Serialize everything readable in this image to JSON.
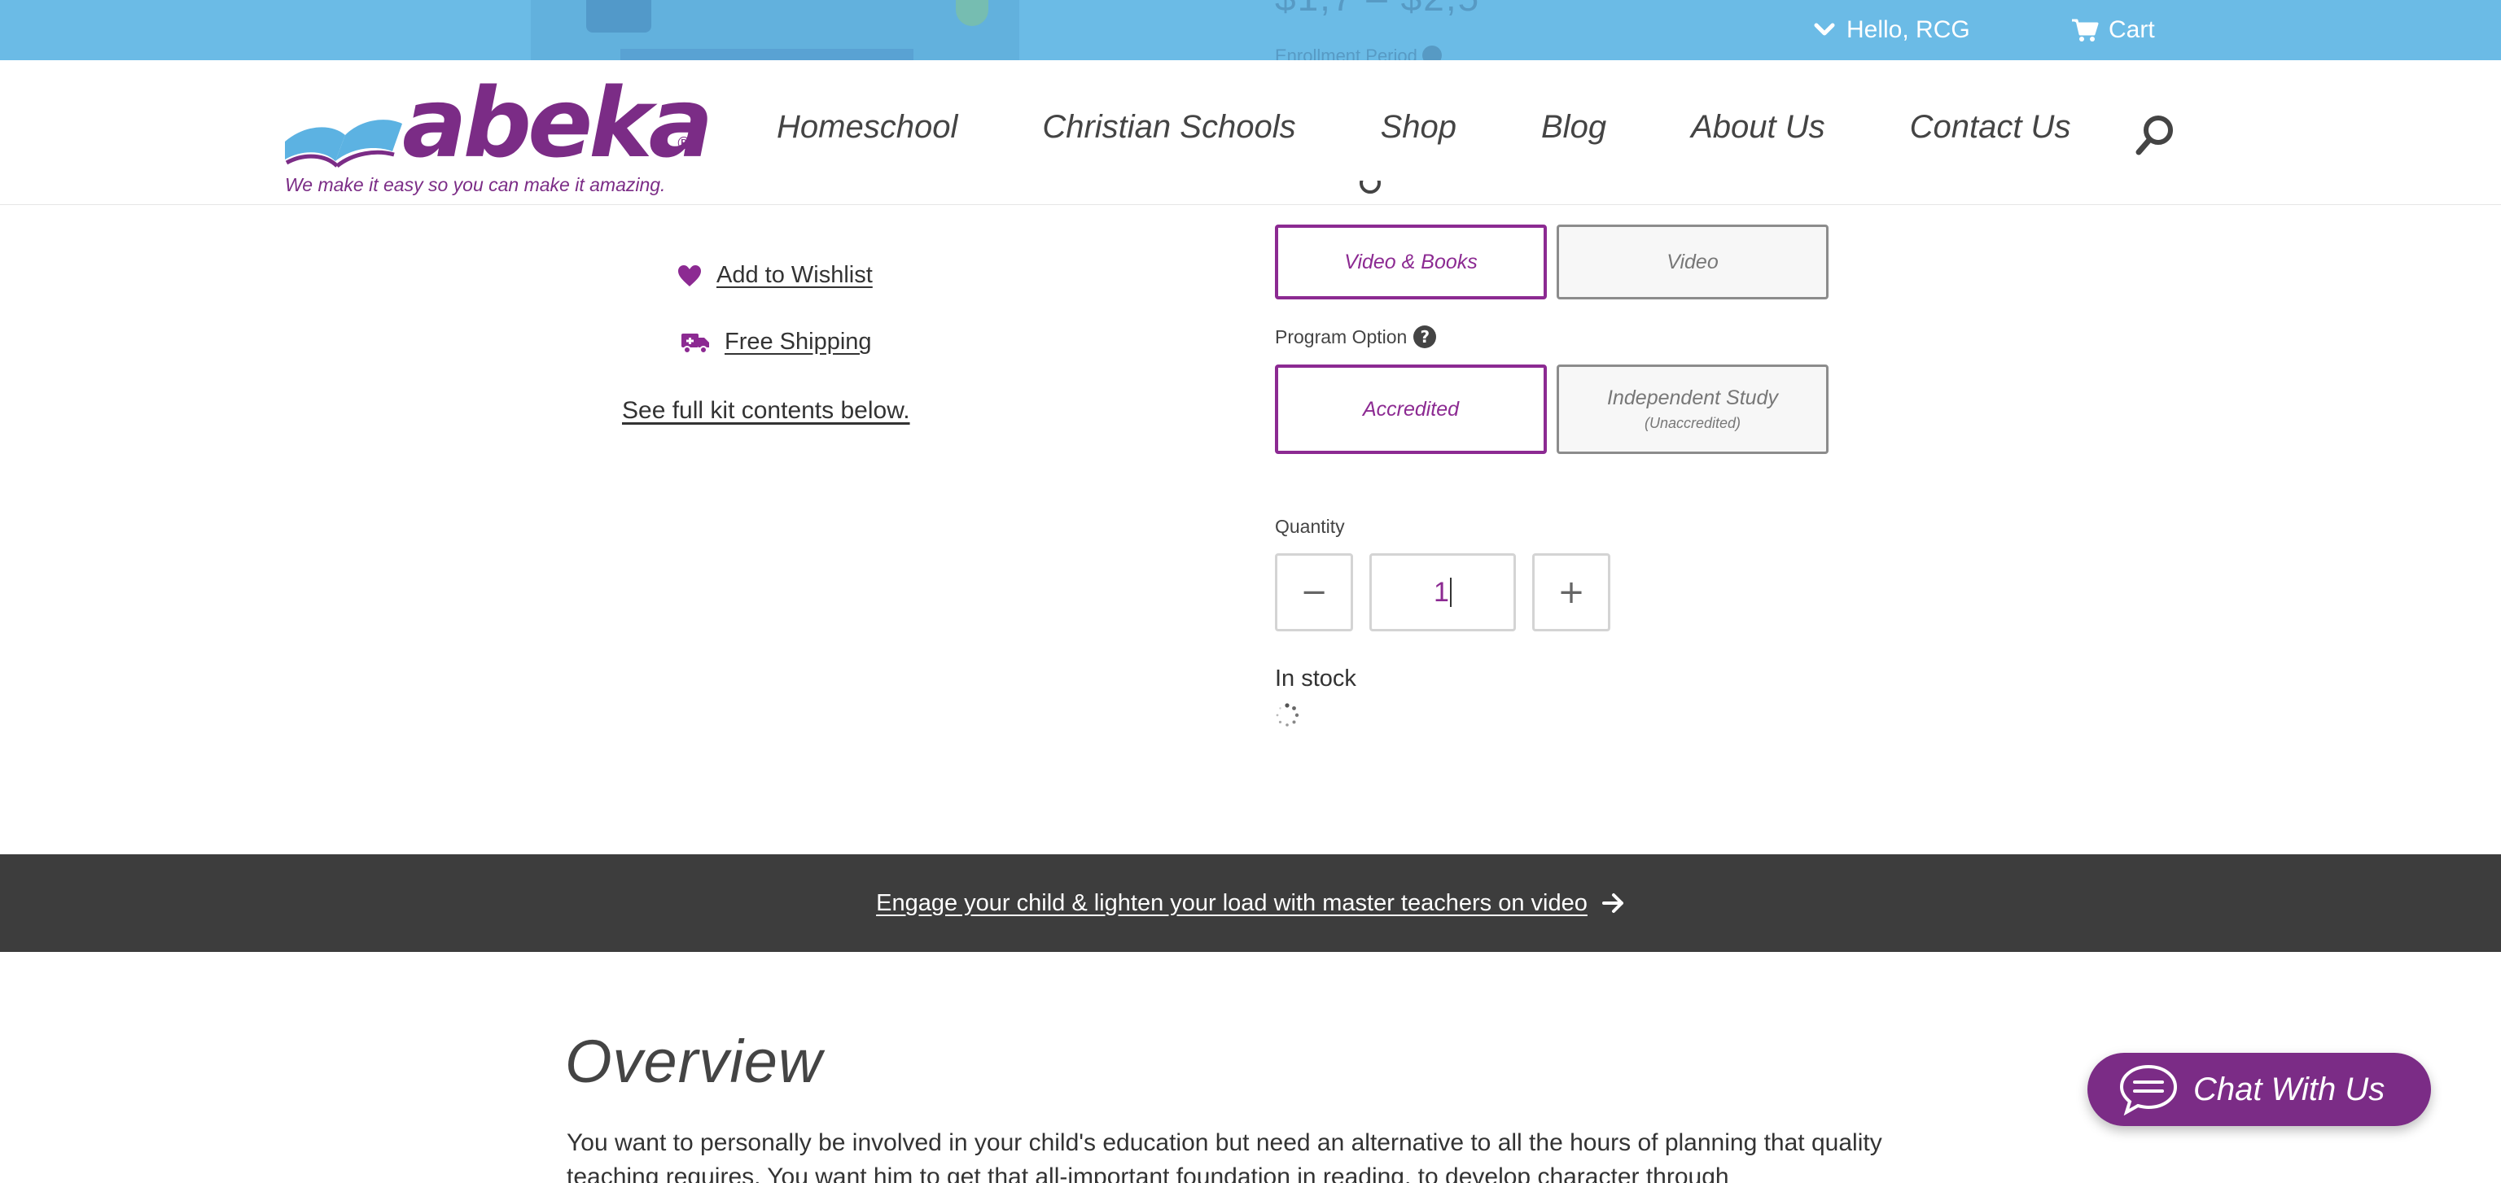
{
  "utility_bar": {
    "hello_label": "Hello, RCG",
    "cart_label": "Cart",
    "peek_price": "$1,7 – $2,5",
    "peek_label": "Enrollment Period",
    "background_color": "#6bbbe6"
  },
  "brand": {
    "wordmark": "abeka",
    "registered_mark": "®",
    "tagline": "We make it easy so you can make it amazing.",
    "color": "#7b2c86"
  },
  "nav": {
    "items": [
      {
        "label": "Homeschool"
      },
      {
        "label": "Christian Schools"
      },
      {
        "label": "Shop"
      },
      {
        "label": "Blog"
      },
      {
        "label": "About Us"
      },
      {
        "label": "Contact Us"
      }
    ],
    "search_icon": "search-icon"
  },
  "product_links": {
    "wishlist": "Add to Wishlist",
    "shipping": "Free Shipping",
    "kit_contents": "See full kit contents below."
  },
  "format_options": [
    {
      "label": "Video & Books",
      "selected": true
    },
    {
      "label": "Video",
      "selected": false
    }
  ],
  "program_option": {
    "label": "Program Option",
    "options": [
      {
        "label": "Accredited",
        "sublabel": "",
        "selected": true
      },
      {
        "label": "Independent Study",
        "sublabel": "(Unaccredited)",
        "selected": false
      }
    ]
  },
  "quantity": {
    "label": "Quantity",
    "value": "1",
    "decrement_label": "−",
    "increment_label": "+"
  },
  "stock_status": "In stock",
  "promo": {
    "text": "Engage your child & lighten your load with master teachers on video"
  },
  "overview": {
    "title": "Overview",
    "text": "You want to personally be involved in your child's education but need an alternative to all the hours of planning that quality teaching requires. You want him to get that all-important foundation in reading, to develop character through"
  },
  "chat": {
    "label": "Chat With Us"
  },
  "colors": {
    "accent": "#8c2a92",
    "promo_band": "#3d3d3d"
  }
}
